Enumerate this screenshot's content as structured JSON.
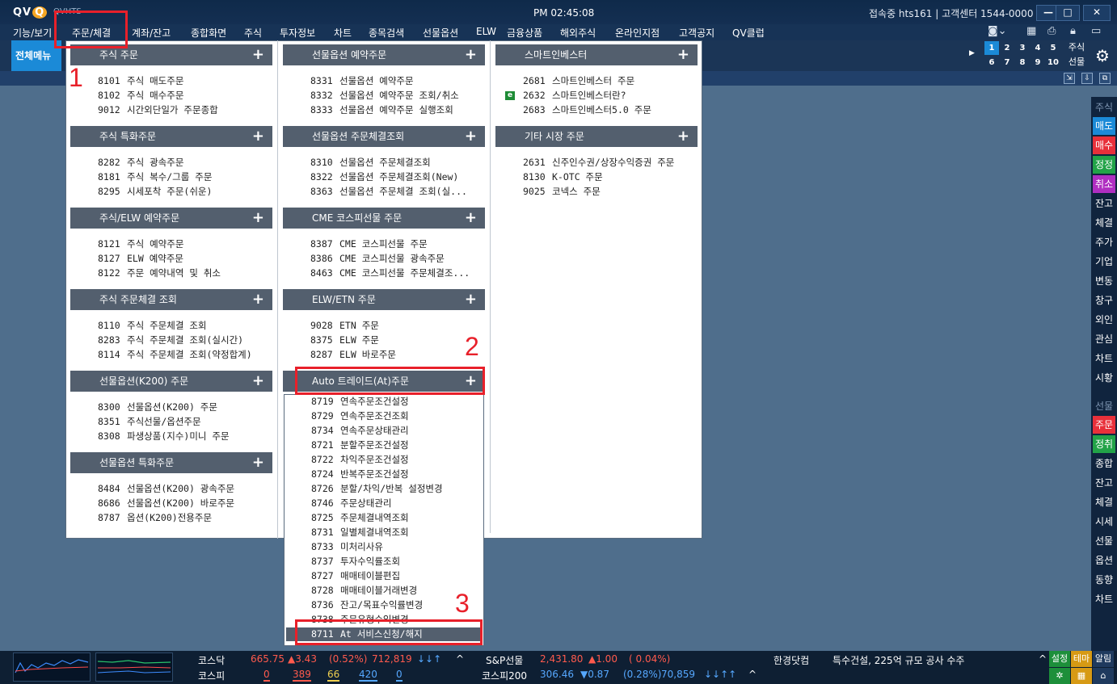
{
  "titlebar": {
    "logo": "QV",
    "logo_q": "Q",
    "app_name": "QVHTS",
    "time": "PM 02:45:08",
    "connection": "접속중 hts161 | 고객센터 1544-0000",
    "minimize": "—",
    "maximize": "□",
    "close": "✕"
  },
  "menubar": {
    "items": [
      "기능/보기",
      "주문/체결",
      "계좌/잔고",
      "종합화면",
      "주식",
      "투자정보",
      "차트",
      "종목검색",
      "선물옵션",
      "ELW",
      "금융상품",
      "해외주식",
      "온라인지점",
      "고객공지",
      "QV클럽"
    ]
  },
  "toolbar": {
    "full_menu": "전체메뉴",
    "screen_numbers": [
      "1",
      "2",
      "3",
      "4",
      "5",
      "6",
      "7",
      "8",
      "9",
      "10"
    ],
    "stock_tab": "주식",
    "futures_tab": "선물"
  },
  "dropdown": {
    "col1": [
      {
        "title": "주식 주문",
        "items": [
          [
            "8101",
            "주식 매도주문"
          ],
          [
            "8102",
            "주식 매수주문"
          ],
          [
            "9012",
            "시간외단일가 주문종합"
          ]
        ]
      },
      {
        "title": "주식 특화주문",
        "items": [
          [
            "8282",
            "주식 광속주문"
          ],
          [
            "8181",
            "주식 복수/그룹 주문"
          ],
          [
            "8295",
            "시세포착 주문(쉬운)"
          ]
        ]
      },
      {
        "title": "주식/ELW 예약주문",
        "items": [
          [
            "8121",
            "주식 예약주문"
          ],
          [
            "8127",
            "ELW 예약주문"
          ],
          [
            "8122",
            "주문 예약내역 및 취소"
          ]
        ]
      },
      {
        "title": "주식 주문체결 조회",
        "items": [
          [
            "8110",
            "주식 주문체결 조회"
          ],
          [
            "8283",
            "주식 주문체결 조회(실시간)"
          ],
          [
            "8114",
            "주식 주문체결 조회(약정합계)"
          ]
        ]
      },
      {
        "title": "선물옵션(K200) 주문",
        "items": [
          [
            "8300",
            "선물옵션(K200) 주문"
          ],
          [
            "8351",
            "주식선물/옵션주문"
          ],
          [
            "8308",
            "파생상품(지수)미니 주문"
          ]
        ]
      },
      {
        "title": "선물옵션 특화주문",
        "items": [
          [
            "8484",
            "선물옵션(K200) 광속주문"
          ],
          [
            "8686",
            "선물옵션(K200) 바로주문"
          ],
          [
            "8787",
            "옵션(K200)전용주문"
          ]
        ]
      }
    ],
    "col2": [
      {
        "title": "선물옵션 예약주문",
        "items": [
          [
            "8331",
            "선물옵션 예약주문"
          ],
          [
            "8332",
            "선물옵션 예약주문 조회/취소"
          ],
          [
            "8333",
            "선물옵션 예약주문 실행조회"
          ]
        ]
      },
      {
        "title": "선물옵션 주문체결조회",
        "items": [
          [
            "8310",
            "선물옵션 주문체결조회"
          ],
          [
            "8322",
            "선물옵션 주문체결조회(New)"
          ],
          [
            "8363",
            "선물옵션 주문체결 조회(실..."
          ]
        ]
      },
      {
        "title": "CME 코스피선물 주문",
        "items": [
          [
            "8387",
            "CME 코스피선물 주문"
          ],
          [
            "8386",
            "CME 코스피선물 광속주문"
          ],
          [
            "8463",
            "CME 코스피선물 주문체결조..."
          ]
        ]
      },
      {
        "title": "ELW/ETN 주문",
        "items": [
          [
            "9028",
            "ETN 주문"
          ],
          [
            "8375",
            "ELW 주문"
          ],
          [
            "8287",
            "ELW 바로주문"
          ]
        ]
      },
      {
        "title": "Auto 트레이드(At)주문",
        "items": []
      }
    ],
    "col3": [
      {
        "title": "스마트인베스터",
        "items": [
          [
            "2681",
            "스마트인베스터 주문"
          ],
          [
            "2632",
            "스마트인베스터란?"
          ],
          [
            "2683",
            "스마트인베스터5.0 주문"
          ]
        ]
      },
      {
        "title": "기타 시장 주문",
        "items": [
          [
            "2631",
            "신주인수권/상장수익증권 주문"
          ],
          [
            "8130",
            "K-OTC 주문"
          ],
          [
            "9025",
            "코넥스 주문"
          ]
        ]
      }
    ],
    "e_badge": "e"
  },
  "auto_submenu": {
    "items": [
      [
        "8719",
        "연속주문조건설정"
      ],
      [
        "8729",
        "연속주문조건조회"
      ],
      [
        "8734",
        "연속주문상태관리"
      ],
      [
        "8721",
        "분할주문조건설정"
      ],
      [
        "8722",
        "차익주문조건설정"
      ],
      [
        "8724",
        "반복주문조건설정"
      ],
      [
        "8726",
        "분할/차익/반복 설정변경"
      ],
      [
        "8746",
        "주문상태관리"
      ],
      [
        "8725",
        "주문체결내역조회"
      ],
      [
        "8731",
        "일별체결내역조회"
      ],
      [
        "8733",
        "미처리사유"
      ],
      [
        "8737",
        "투자수익률조회"
      ],
      [
        "8727",
        "매매테이블편집"
      ],
      [
        "8728",
        "매매테이블거래변경"
      ],
      [
        "8736",
        "잔고/목표수익률변경"
      ],
      [
        "8738",
        "주문유형수익변경"
      ],
      [
        "8711",
        "At 서비스신청/해지"
      ]
    ]
  },
  "annotations": [
    "1",
    "2",
    "3"
  ],
  "right_sidebar": {
    "stock_head": "주식",
    "stock_items": [
      "매도",
      "매수",
      "정정",
      "취소",
      "잔고",
      "체결",
      "주가",
      "기업",
      "변동",
      "창구",
      "외인",
      "관심",
      "차트",
      "시황"
    ],
    "futures_head": "선물",
    "futures_items": [
      "주문",
      "정취",
      "종합",
      "잔고",
      "체결",
      "시세",
      "선물",
      "옵션",
      "동향",
      "차트"
    ]
  },
  "bottombar": {
    "kosdaq_label": "코스닥",
    "kosdaq_value": "665.75",
    "kosdaq_change": "▲3.43",
    "kosdaq_pct": "(0.52%)",
    "kosdaq_volume": "712,819",
    "kosdaq_arrows": "↓↓↑",
    "kospi_label": "코스피",
    "kospi_up": "0",
    "kospi_a": "389",
    "kospi_b": "66",
    "kospi_c": "420",
    "kospi_d": "0",
    "sp_label": "S&P선물",
    "sp_value": "2,431.80",
    "sp_change": "▲1.00",
    "sp_pct": "( 0.04%)",
    "k200_label": "코스피200",
    "k200_value": "306.46",
    "k200_change": "▼0.87",
    "k200_pct": "(0.28%)",
    "k200_volume": "70,859",
    "k200_arrows": "↓↓↑↑",
    "news_source": "한경닷컴",
    "news_text": "특수건설, 225억 규모 공사 수주",
    "settings": "설정",
    "theme": "테마",
    "alert": "알림",
    "caret": "^"
  }
}
